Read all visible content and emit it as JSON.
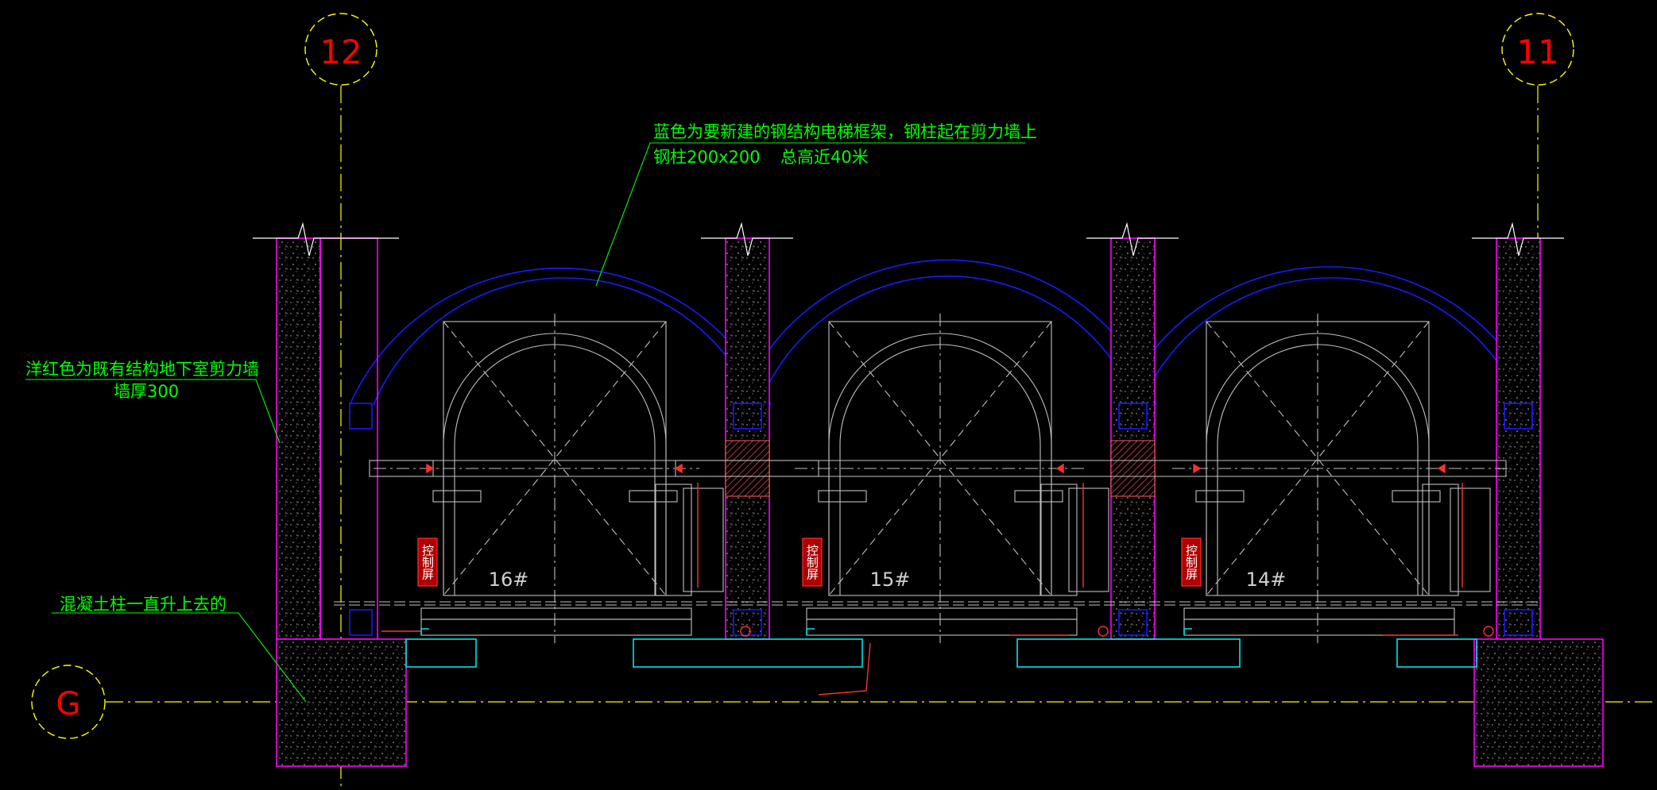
{
  "grid_axes": {
    "left_axis": "12",
    "right_axis": "11",
    "row_axis": "G"
  },
  "annotations": {
    "steel_frame_line1": "蓝色为要新建的钢结构电梯框架，钢柱起在剪力墙上",
    "steel_frame_line2": "钢柱200x200",
    "total_height": "总高近40米",
    "shear_wall_line1": "洋红色为既有结构地下室剪力墙",
    "shear_wall_line2": "墙厚300",
    "concrete_column": "混凝土柱一直升上去的"
  },
  "elevators": [
    {
      "number": "16#",
      "panel_label": "控制屏"
    },
    {
      "number": "15#",
      "panel_label": "控制屏"
    },
    {
      "number": "14#",
      "panel_label": "控制屏"
    }
  ],
  "colors": {
    "background": "#000000",
    "axis_line": "#ffff00",
    "axis_bubble_text": "#ff0000",
    "annotation_text": "#00ff00",
    "steel_frame": "#0000ff",
    "shear_wall": "#ff00ff",
    "door_sill": "#00ffff",
    "car_outline": "#c0c0c0",
    "marker": "#ff0000"
  }
}
